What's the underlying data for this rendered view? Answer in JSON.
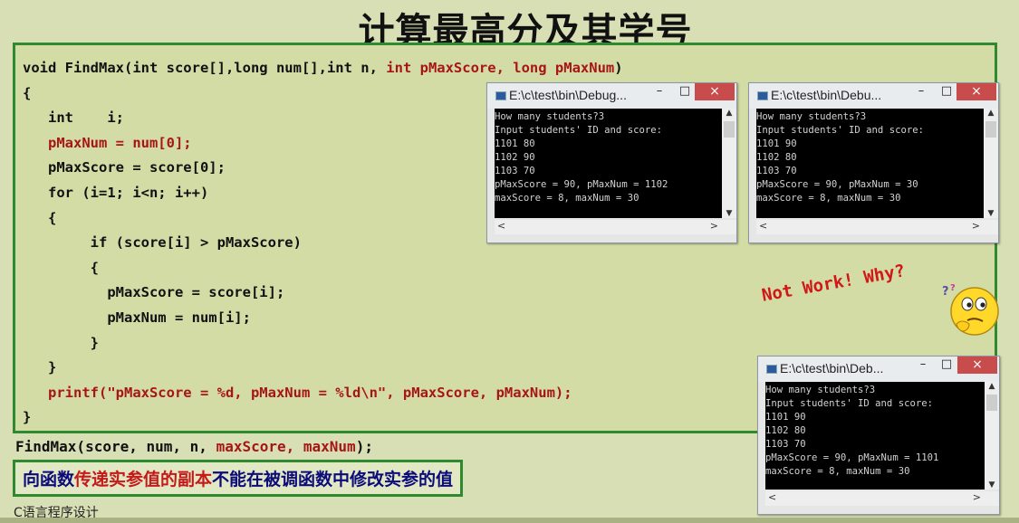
{
  "slide": {
    "title": "计算最高分及其学号",
    "footer": "C语言程序设计"
  },
  "code": {
    "sig_black": "void FindMax(int score[],long num[],int n, ",
    "sig_red": "int pMaxScore, long pMaxNum",
    "sig_end": ")",
    "open_brace": "{",
    "decl": "   int    i;",
    "line_maxnum": "   pMaxNum = num[0];",
    "line_maxscore": "   pMaxScore = score[0];",
    "for_line": "   for (i=1; i<n; i++)",
    "for_open": "   {",
    "if_line": "        if (score[i] > pMaxScore)",
    "if_open": "        {",
    "assign_score": "          pMaxScore = score[i];",
    "assign_num": "          pMaxNum = num[i];",
    "if_close": "        }",
    "for_close": "   }",
    "printf_line": "   printf(\"pMaxScore = %d, pMaxNum = %ld\\n\", pMaxScore, pMaxNum);",
    "close_brace": "}"
  },
  "call": {
    "prefix": "FindMax(score, num, n, ",
    "args_red": "maxScore, maxNum",
    "suffix": ");"
  },
  "note": {
    "part1": "向函数",
    "part2_red": "传递实参值的副本",
    "part3": "不能在被调函数中修改实参的值"
  },
  "annotation": {
    "text": "Not Work! Why?",
    "icon": "thinking-face-icon"
  },
  "windows": [
    {
      "title": "E:\\c\\test\\bin\\Debug...",
      "output": "How many students?3\nInput students' ID and score:\n1101 80\n1102 90\n1103 70\npMaxScore = 90, pMaxNum = 1102\nmaxScore = 8, maxNum = 30"
    },
    {
      "title": "E:\\c\\test\\bin\\Debu...",
      "output": "How many students?3\nInput students' ID and score:\n1101 90\n1102 80\n1103 70\npMaxScore = 90, pMaxNum = 30\nmaxScore = 8, maxNum = 30"
    },
    {
      "title": "E:\\c\\test\\bin\\Deb...",
      "output": "How many students?3\nInput students' ID and score:\n1101 90\n1102 80\n1103 70\npMaxScore = 90, pMaxNum = 1101\nmaxScore = 8, maxNum = 30"
    }
  ],
  "window_buttons": {
    "minimize": "–",
    "maximize": "□",
    "close": "×",
    "scroll_up": "▲",
    "scroll_down": "▼",
    "scroll_left": "<",
    "scroll_right": ">"
  },
  "colors": {
    "accent_green": "#2f8a2f",
    "code_red": "#a71616",
    "note_blue": "#0b0b7a",
    "close_red": "#c94c4c"
  }
}
